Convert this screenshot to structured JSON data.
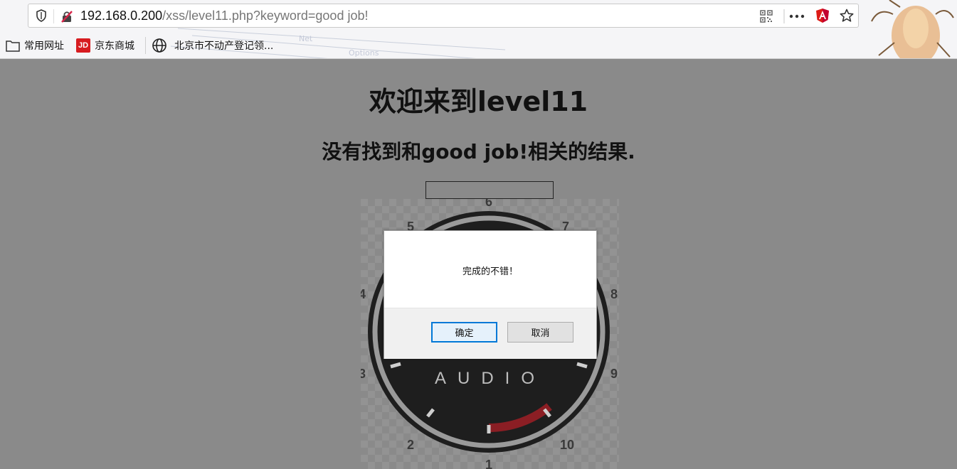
{
  "browser": {
    "url_host": "192.168.0.200",
    "url_path": "/xss/level11.php?keyword=good job!",
    "icons": [
      "shield-icon",
      "insecure-lock-icon",
      "qr-code-icon",
      "more-menu-icon",
      "angular-icon",
      "bookmark-star-icon"
    ]
  },
  "bookmarks": [
    {
      "label": "常用网址",
      "icon": "folder-icon"
    },
    {
      "label": "京东商城",
      "icon": "jd-icon"
    },
    {
      "label": "北京市不动产登记领...",
      "icon": "globe-icon"
    }
  ],
  "page": {
    "title": "欢迎来到level11",
    "result_text": "没有找到和good job!相关的结果.",
    "search_value": ""
  },
  "gauge": {
    "label": "AUDIO",
    "numbers": [
      "6",
      "5",
      "7",
      "4",
      "8",
      "3",
      "9",
      "2",
      "10",
      "1"
    ]
  },
  "dialog": {
    "message": "完成的不错！",
    "ok_label": "确定",
    "cancel_label": "取消"
  },
  "colors": {
    "overlay": "#8a8a8a",
    "gauge_accent": "#8b1e24",
    "focus_border": "#0078d7"
  }
}
